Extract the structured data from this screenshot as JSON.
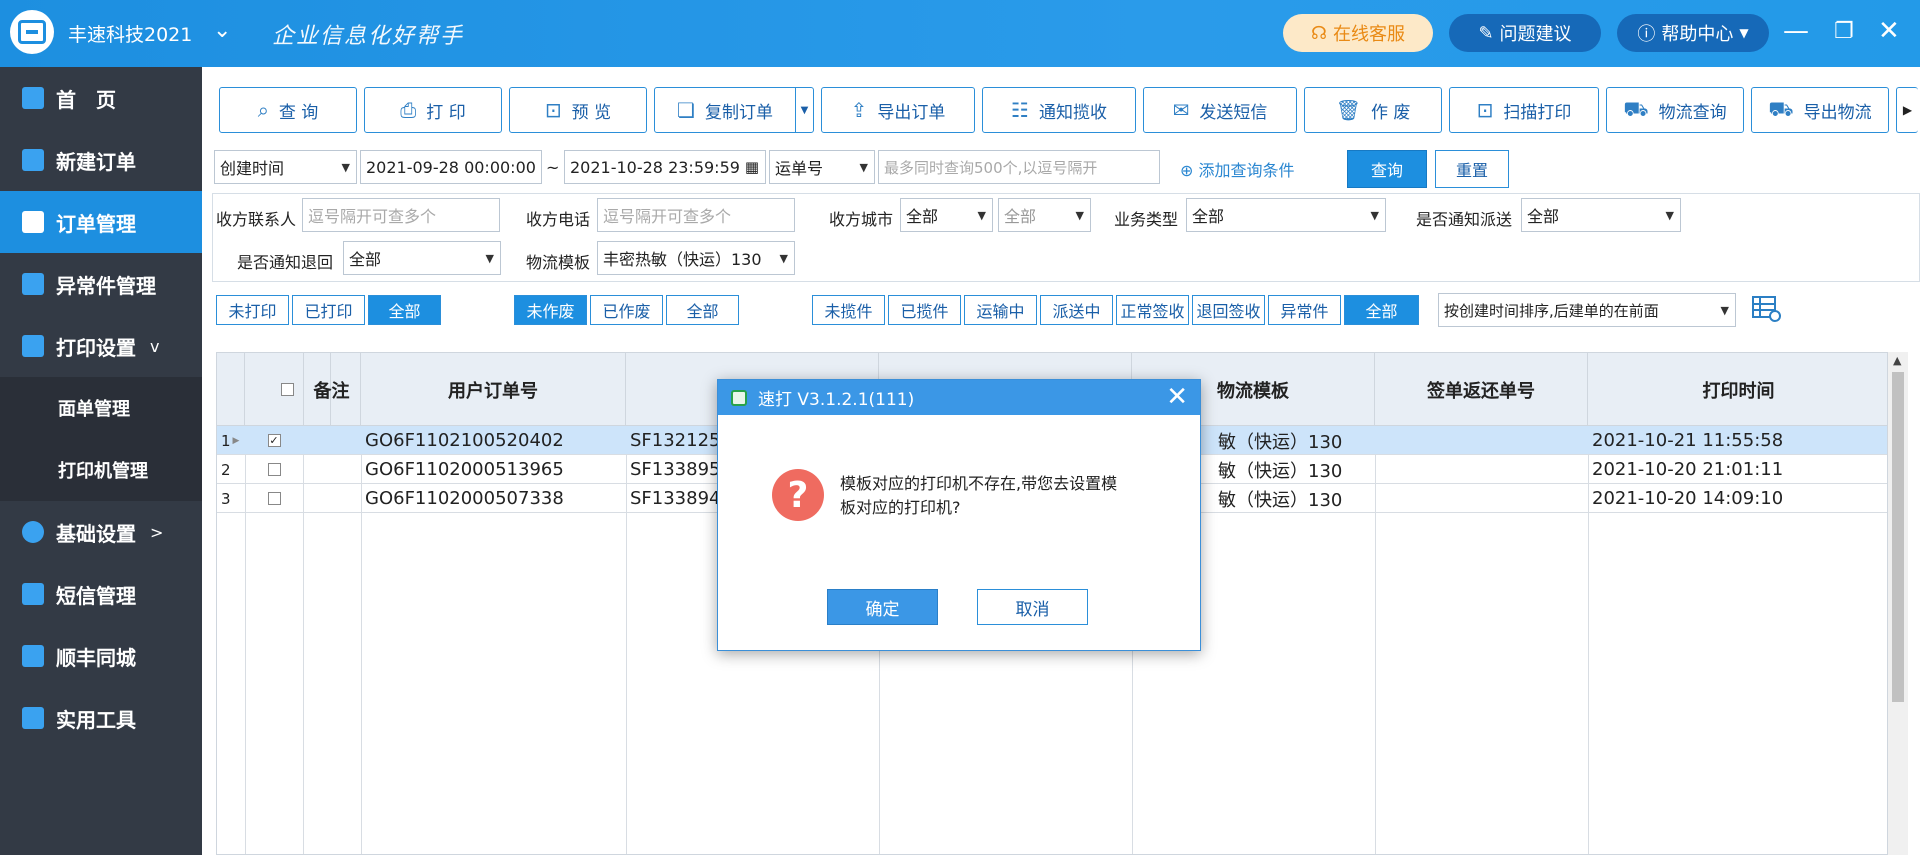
{
  "app": {
    "name": "丰速科技2021",
    "slogan": "企业信息化好帮手"
  },
  "header": {
    "service": "在线客服",
    "suggest": "问题建议",
    "help": "帮助中心"
  },
  "sidebar": {
    "items": [
      {
        "label": "首　页"
      },
      {
        "label": "新建订单"
      },
      {
        "label": "订单管理"
      },
      {
        "label": "异常件管理"
      },
      {
        "label": "打印设置",
        "suffix": "v"
      },
      {
        "label": "面单管理"
      },
      {
        "label": "打印机管理"
      },
      {
        "label": "基础设置",
        "suffix": ">"
      },
      {
        "label": "短信管理"
      },
      {
        "label": "顺丰同城"
      },
      {
        "label": "实用工具"
      }
    ]
  },
  "toolbar": {
    "query": "查 询",
    "print": "打 印",
    "preview": "预 览",
    "copy_order": "复制订单",
    "export_order": "导出订单",
    "notify_pickup": "通知揽收",
    "send_sms": "发送短信",
    "void": "作 废",
    "scan_print": "扫描打印",
    "logistics_query": "物流查询",
    "export_logistics": "导出物流"
  },
  "filters": {
    "date_field": "创建时间",
    "date_from": "2021-09-28 00:00:00",
    "tilde": "~",
    "date_to": "2021-10-28 23:59:59",
    "no_field": "运单号",
    "no_placeholder": "最多同时查询500个,以逗号隔开",
    "add_condition": "添加查询条件",
    "query_btn": "查询",
    "reset_btn": "重置",
    "receiver_contact_label": "收方联系人",
    "receiver_contact_ph": "逗号隔开可查多个",
    "receiver_phone_label": "收方电话",
    "receiver_phone_ph": "逗号隔开可查多个",
    "receiver_city_label": "收方城市",
    "city1": "全部",
    "city2": "全部",
    "biz_type_label": "业务类型",
    "biz_type": "全部",
    "notify_delivery_label": "是否通知派送",
    "notify_delivery": "全部",
    "notify_return_label": "是否通知退回",
    "notify_return": "全部",
    "template_label": "物流模板",
    "template": "丰密热敏（快运）130"
  },
  "chips": {
    "unprinted": "未打印",
    "printed": "已打印",
    "all1": "全部",
    "not_void": "未作废",
    "voided": "已作废",
    "all2": "全部",
    "not_picked": "未揽件",
    "picked": "已揽件",
    "in_transit": "运输中",
    "delivering": "派送中",
    "signed": "正常签收",
    "return_signed": "退回签收",
    "abnormal": "异常件",
    "all3": "全部",
    "sort": "按创建时间排序,后建单的在前面"
  },
  "table": {
    "headers": {
      "remark": "备注",
      "user_order": "用户订单号",
      "template": "物流模板",
      "return_no": "签单返还单号",
      "print_time": "打印时间"
    },
    "rows": [
      {
        "idx": "1",
        "checked": "✓",
        "user_order": "GO6F1102100520402",
        "waybill": "SF132125",
        "template": "敏（快运）130",
        "print_time": "2021-10-21 11:55:58"
      },
      {
        "idx": "2",
        "checked": "",
        "user_order": "GO6F1102000513965",
        "waybill": "SF133895",
        "template": "敏（快运）130",
        "print_time": "2021-10-20 21:01:11"
      },
      {
        "idx": "3",
        "checked": "",
        "user_order": "GO6F1102000507338",
        "waybill": "SF133894",
        "template": "敏（快运）130",
        "print_time": "2021-10-20 14:09:10"
      }
    ]
  },
  "dialog": {
    "title": "速打 V3.1.2.1(111)",
    "message": "模板对应的打印机不存在,带您去设置模板对应的打印机?",
    "ok": "确定",
    "cancel": "取消"
  }
}
